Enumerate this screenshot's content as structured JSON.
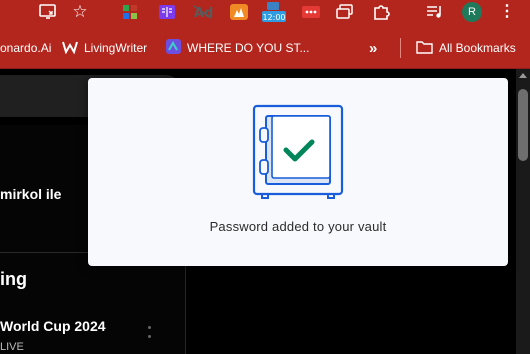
{
  "toolbar": {
    "avatar_letter": "R",
    "badge_time": "12:00",
    "icons": [
      "cast-icon",
      "star-icon",
      "extension-icon",
      "extension-icon",
      "extension-icon",
      "extension-icon",
      "extension-icon",
      "extension-icon",
      "extension-icon",
      "puzzle-icon",
      "media-icon",
      "avatar",
      "menu-icon"
    ]
  },
  "bookmarks": {
    "items": [
      {
        "label": "onardo.Ai"
      },
      {
        "label": "LivingWriter"
      },
      {
        "label": "WHERE DO YOU ST..."
      }
    ],
    "more": "»",
    "all_bookmarks": "All Bookmarks"
  },
  "page": {
    "text_1": "mirkol ile",
    "text_2": "ing",
    "text_3": "World Cup 2024",
    "text_4": "LIVE"
  },
  "popup": {
    "message": "Password added to your vault",
    "icon": "vault-check-icon",
    "accent_color": "#175ddc",
    "check_color": "#00865a"
  }
}
